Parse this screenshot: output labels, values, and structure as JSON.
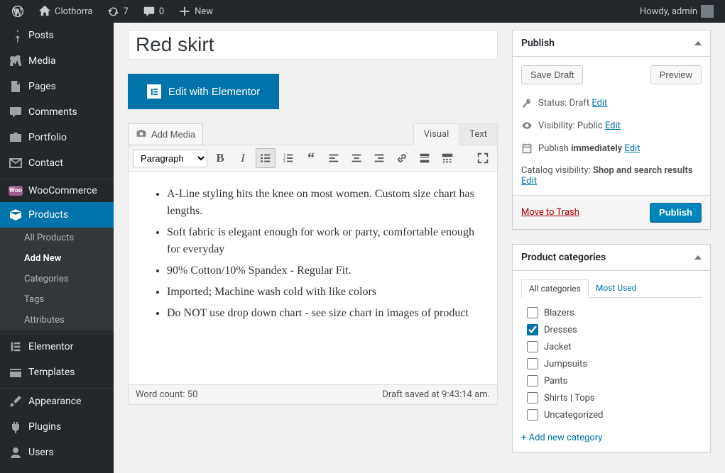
{
  "toolbar": {
    "site_name": "Clothorra",
    "updates_count": "7",
    "comments_count": "0",
    "new_label": "New",
    "howdy": "Howdy, admin"
  },
  "sidebar": {
    "items": [
      {
        "label": "Posts"
      },
      {
        "label": "Media"
      },
      {
        "label": "Pages"
      },
      {
        "label": "Comments"
      },
      {
        "label": "Portfolio"
      },
      {
        "label": "Contact"
      },
      {
        "label": "WooCommerce"
      },
      {
        "label": "Products"
      },
      {
        "label": "Elementor"
      },
      {
        "label": "Templates"
      },
      {
        "label": "Appearance"
      },
      {
        "label": "Plugins"
      },
      {
        "label": "Users"
      }
    ],
    "submenu": [
      {
        "label": "All Products"
      },
      {
        "label": "Add New"
      },
      {
        "label": "Categories"
      },
      {
        "label": "Tags"
      },
      {
        "label": "Attributes"
      }
    ]
  },
  "post": {
    "title": "Red skirt",
    "elementor_btn": "Edit with Elementor",
    "add_media": "Add Media",
    "tab_visual": "Visual",
    "tab_text": "Text",
    "format_select": "Paragraph",
    "bullets": [
      "A-Line styling hits the knee on most women. Custom size chart has lengths.",
      "Soft fabric is elegant enough for work or party, comfortable enough for everyday",
      "90% Cotton/10% Spandex - Regular Fit.",
      "Imported; Machine wash cold with like colors",
      "Do NOT use drop down chart - see size chart in images of product"
    ],
    "word_count_label": "Word count: ",
    "word_count": "50",
    "draft_saved": "Draft saved at 9:43:14 am."
  },
  "publish": {
    "heading": "Publish",
    "save_draft": "Save Draft",
    "preview": "Preview",
    "status_label": "Status: ",
    "status_value": "Draft",
    "visibility_label": "Visibility: ",
    "visibility_value": "Public",
    "schedule_label": "Publish ",
    "schedule_value": "immediately",
    "catalog_label": "Catalog visibility: ",
    "catalog_value": "Shop and search results",
    "edit": "Edit",
    "trash": "Move to Trash",
    "publish_btn": "Publish"
  },
  "categories": {
    "heading": "Product categories",
    "tab_all": "All categories",
    "tab_most": "Most Used",
    "list": [
      {
        "label": "Blazers",
        "checked": false
      },
      {
        "label": "Dresses",
        "checked": true
      },
      {
        "label": "Jacket",
        "checked": false
      },
      {
        "label": "Jumpsuits",
        "checked": false
      },
      {
        "label": "Pants",
        "checked": false
      },
      {
        "label": "Shirts | Tops",
        "checked": false
      },
      {
        "label": "Uncategorized",
        "checked": false
      }
    ],
    "add_new": "+ Add new category"
  }
}
